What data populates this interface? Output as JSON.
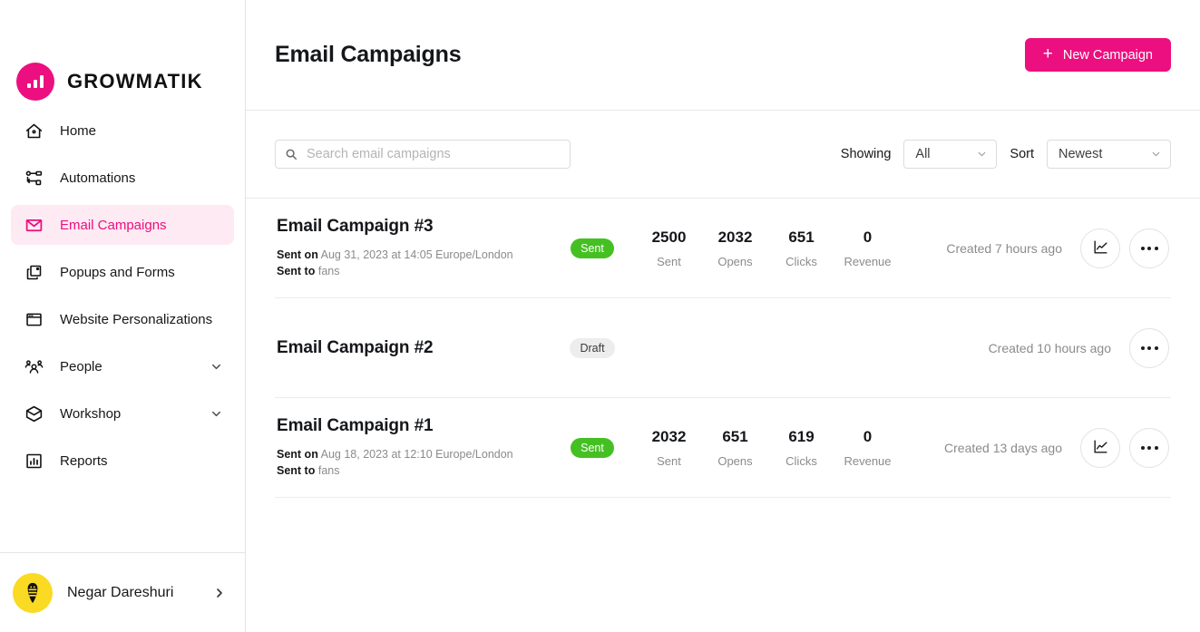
{
  "brand": {
    "name": "GROWMATIK",
    "logo_icon": "bar-chart-logo-icon",
    "accent_color": "#ec0f7f"
  },
  "sidebar": {
    "items": [
      {
        "label": "Home",
        "icon": "home-icon",
        "active": false,
        "expandable": false
      },
      {
        "label": "Automations",
        "icon": "automations-icon",
        "active": false,
        "expandable": false
      },
      {
        "label": "Email Campaigns",
        "icon": "envelope-icon",
        "active": true,
        "expandable": false
      },
      {
        "label": "Popups and Forms",
        "icon": "popups-icon",
        "active": false,
        "expandable": false
      },
      {
        "label": "Website Personalizations",
        "icon": "browser-window-icon",
        "active": false,
        "expandable": false
      },
      {
        "label": "People",
        "icon": "people-icon",
        "active": false,
        "expandable": true
      },
      {
        "label": "Workshop",
        "icon": "box-icon",
        "active": false,
        "expandable": true
      },
      {
        "label": "Reports",
        "icon": "reports-bar-chart-icon",
        "active": false,
        "expandable": false
      }
    ],
    "user": {
      "name": "Negar Dareshuri",
      "avatar_icon": "bee-avatar-icon",
      "chevron_icon": "chevron-right-icon",
      "avatar_color": "#fada22"
    }
  },
  "header": {
    "title": "Email Campaigns",
    "new_campaign_label": "New Campaign",
    "new_campaign_icon": "plus-icon"
  },
  "toolbar": {
    "search": {
      "placeholder": "Search email campaigns",
      "value": "",
      "icon": "search-icon"
    },
    "showing": {
      "label": "Showing",
      "value": "All",
      "chevron_icon": "chevron-down-icon"
    },
    "sort": {
      "label": "Sort",
      "value": "Newest",
      "chevron_icon": "chevron-down-icon"
    }
  },
  "campaigns": [
    {
      "name": "Email Campaign #3",
      "sent_on_label": "Sent on",
      "sent_on_value": "Aug 31, 2023 at 14:05 Europe/London",
      "sent_to_label": "Sent to",
      "sent_to_value": "fans",
      "status": "Sent",
      "status_type": "sent",
      "stats": [
        {
          "value": "2500",
          "caption": "Sent"
        },
        {
          "value": "2032",
          "caption": "Opens"
        },
        {
          "value": "651",
          "caption": "Clicks"
        },
        {
          "value": "0",
          "caption": "Revenue"
        }
      ],
      "created": "Created 7 hours ago",
      "has_report": true,
      "report_icon": "line-chart-icon",
      "menu_icon": "more-options-icon"
    },
    {
      "name": "Email Campaign #2",
      "sent_on_label": "",
      "sent_on_value": "",
      "sent_to_label": "",
      "sent_to_value": "",
      "status": "Draft",
      "status_type": "draft",
      "stats": [],
      "created": "Created 10 hours ago",
      "has_report": false,
      "report_icon": "",
      "menu_icon": "more-options-icon"
    },
    {
      "name": "Email Campaign #1",
      "sent_on_label": "Sent on",
      "sent_on_value": "Aug 18, 2023 at 12:10 Europe/London",
      "sent_to_label": "Sent to",
      "sent_to_value": "fans",
      "status": "Sent",
      "status_type": "sent",
      "stats": [
        {
          "value": "2032",
          "caption": "Sent"
        },
        {
          "value": "651",
          "caption": "Opens"
        },
        {
          "value": "619",
          "caption": "Clicks"
        },
        {
          "value": "0",
          "caption": "Revenue"
        }
      ],
      "created": "Created 13 days ago",
      "has_report": true,
      "report_icon": "line-chart-icon",
      "menu_icon": "more-options-icon"
    }
  ]
}
